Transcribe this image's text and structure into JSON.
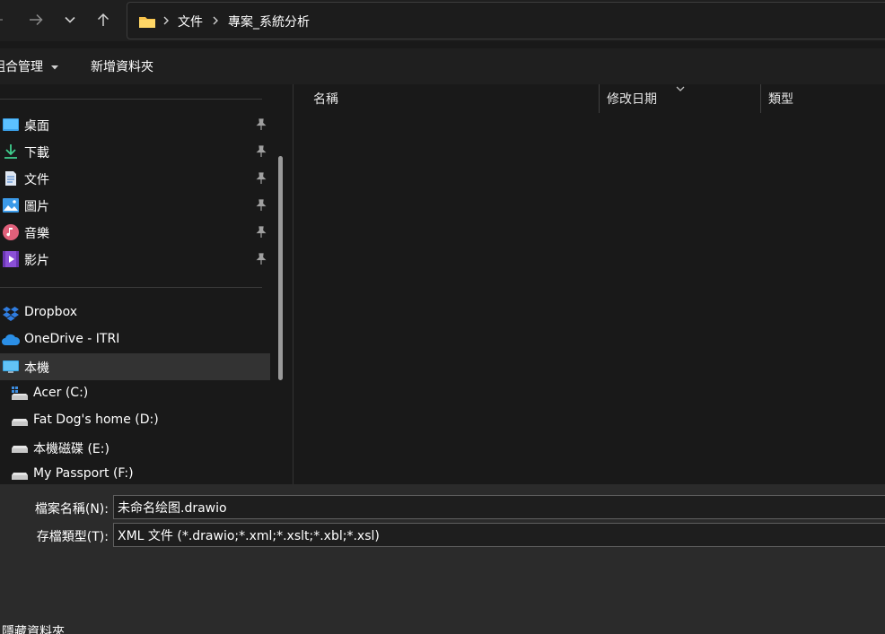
{
  "breadcrumbs": [
    "文件",
    "專案_系統分析"
  ],
  "toolbar": {
    "organize": "組合管理",
    "new_folder": "新增資料夾"
  },
  "nav": {
    "quick_access": [
      {
        "label": "桌面",
        "icon": "desktop-icon"
      },
      {
        "label": "下載",
        "icon": "download-icon"
      },
      {
        "label": "文件",
        "icon": "document-icon"
      },
      {
        "label": "圖片",
        "icon": "pictures-icon"
      },
      {
        "label": "音樂",
        "icon": "music-icon"
      },
      {
        "label": "影片",
        "icon": "videos-icon"
      }
    ],
    "cloud": [
      {
        "label": "Dropbox",
        "icon": "dropbox-icon"
      },
      {
        "label": "OneDrive - ITRI",
        "icon": "onedrive-icon"
      }
    ],
    "this_pc": {
      "label": "本機",
      "icon": "this-pc-icon"
    },
    "drives": [
      {
        "label": "Acer (C:)",
        "icon": "system-drive-icon"
      },
      {
        "label": "Fat Dog's home (D:)",
        "icon": "drive-icon"
      },
      {
        "label": "本機磁碟 (E:)",
        "icon": "drive-icon"
      },
      {
        "label": "My Passport (F:)",
        "icon": "drive-icon"
      }
    ]
  },
  "columns": [
    "名稱",
    "修改日期",
    "類型"
  ],
  "form": {
    "filename_label": "檔案名稱(N):",
    "filename_value": "未命名绘图.drawio",
    "filetype_label": "存檔類型(T):",
    "filetype_value": "XML 文件 (*.drawio;*.xml;*.xslt;*.xbl;*.xsl)"
  },
  "hide_folders": "隱藏資料夾",
  "colors": {
    "background": "#191919",
    "panel": "#2b2b2b",
    "selected": "#333333",
    "folder": "#f8c24a"
  }
}
